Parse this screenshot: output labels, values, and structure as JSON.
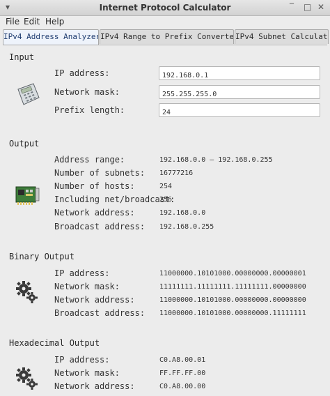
{
  "window": {
    "title": "Internet Protocol Calculator",
    "menu_glyph": "▾",
    "minimize_glyph": "‾",
    "maximize_glyph": "□",
    "close_glyph": "✕"
  },
  "menu": [
    "File",
    "Edit",
    "Help"
  ],
  "tabs": [
    "IPv4 Address Analyzer",
    "IPv4 Range to Prefix Converter",
    "IPv4 Subnet Calculator"
  ],
  "input": {
    "title": "Input",
    "icon": "calculator-icon",
    "fields": [
      {
        "label": "IP address:",
        "value": "192.168.0.1"
      },
      {
        "label": "Network mask:",
        "value": "255.255.255.0"
      },
      {
        "label": "Prefix length:",
        "value": "24"
      }
    ]
  },
  "output": {
    "title": "Output",
    "icon": "network-card-icon",
    "rows": [
      {
        "label": "Address range:",
        "value": "192.168.0.0 – 192.168.0.255"
      },
      {
        "label": "Number of subnets:",
        "value": "16777216"
      },
      {
        "label": "Number of hosts:",
        "value": "254"
      },
      {
        "label": "Including net/broadcast:",
        "value": "256"
      },
      {
        "label": "Network address:",
        "value": "192.168.0.0"
      },
      {
        "label": "Broadcast address:",
        "value": "192.168.0.255"
      }
    ]
  },
  "binary": {
    "title": "Binary Output",
    "icon": "gears-icon",
    "rows": [
      {
        "label": "IP address:",
        "value": "11000000.10101000.00000000.00000001"
      },
      {
        "label": "Network mask:",
        "value": "11111111.11111111.11111111.00000000"
      },
      {
        "label": "Network address:",
        "value": "11000000.10101000.00000000.00000000"
      },
      {
        "label": "Broadcast address:",
        "value": "11000000.10101000.00000000.11111111"
      }
    ]
  },
  "hex": {
    "title": "Hexadecimal Output",
    "icon": "gears-icon",
    "rows": [
      {
        "label": "IP address:",
        "value": "C0.A8.00.01"
      },
      {
        "label": "Network mask:",
        "value": "FF.FF.FF.00"
      },
      {
        "label": "Network address:",
        "value": "C0.A8.00.00"
      }
    ]
  }
}
